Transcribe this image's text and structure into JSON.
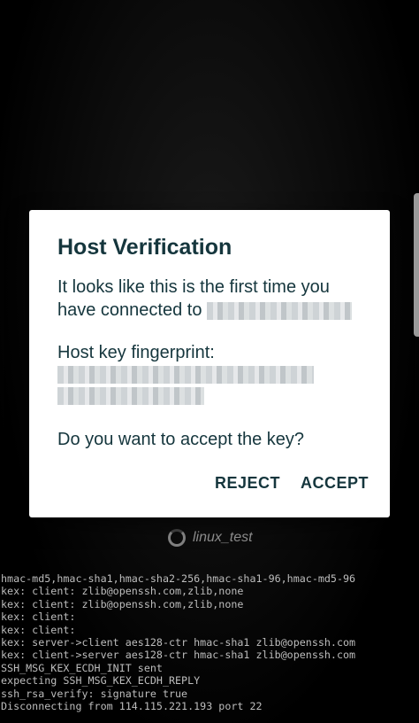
{
  "dialog": {
    "title": "Host Verification",
    "message_line1": "It looks like this is the first time you",
    "message_line2": "have connected to",
    "fingerprint_label": "Host key fingerprint:",
    "question": "Do you want to accept the key?",
    "reject_label": "REJECT",
    "accept_label": "ACCEPT"
  },
  "connection": {
    "host_name": "linux_test",
    "spinner_icon": "loading-spinner-icon"
  },
  "terminal": {
    "lines": [
      "hmac-md5,hmac-sha1,hmac-sha2-256,hmac-sha1-96,hmac-md5-96",
      "kex: client: zlib@openssh.com,zlib,none",
      "kex: client: zlib@openssh.com,zlib,none",
      "kex: client:",
      "kex: client:",
      "kex: server->client aes128-ctr hmac-sha1 zlib@openssh.com",
      "kex: client->server aes128-ctr hmac-sha1 zlib@openssh.com",
      "SSH_MSG_KEX_ECDH_INIT sent",
      "expecting SSH_MSG_KEX_ECDH_REPLY",
      "ssh_rsa_verify: signature true",
      "Disconnecting from 114.115.221.193 port 22"
    ]
  },
  "colors": {
    "dialog_text": "#15363d",
    "dialog_bg": "#ffffff",
    "background": "#000000",
    "terminal_text": "#bdbdbd"
  }
}
